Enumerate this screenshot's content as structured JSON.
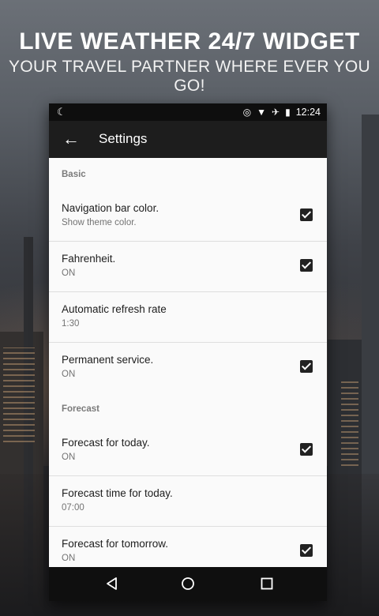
{
  "promo": {
    "headline": "LIVE WEATHER 24/7 WIDGET",
    "subheadline": "YOUR TRAVEL PARTNER WHERE EVER YOU GO!"
  },
  "status_bar": {
    "left_icon": "moon-icon",
    "icons": [
      "circle-target-icon",
      "wifi-icon",
      "airplane-icon",
      "battery-icon"
    ],
    "time": "12:24"
  },
  "app_bar": {
    "back_icon": "arrow-left-icon",
    "title": "Settings"
  },
  "sections": [
    {
      "header": "Basic",
      "items": [
        {
          "title": "Navigation bar color.",
          "summary": "Show theme color.",
          "checked": true
        },
        {
          "title": "Fahrenheit.",
          "summary": "ON",
          "checked": true
        },
        {
          "title": "Automatic refresh rate",
          "summary": "1:30",
          "checked": null
        },
        {
          "title": "Permanent service.",
          "summary": "ON",
          "checked": true
        }
      ]
    },
    {
      "header": "Forecast",
      "items": [
        {
          "title": "Forecast for today.",
          "summary": "ON",
          "checked": true
        },
        {
          "title": "Forecast time for today.",
          "summary": "07:00",
          "checked": null
        },
        {
          "title": "Forecast for tomorrow.",
          "summary": "ON",
          "checked": true
        }
      ]
    }
  ],
  "nav_bar": {
    "icons": [
      "triangle-back-icon",
      "circle-home-icon",
      "square-recents-icon"
    ]
  }
}
